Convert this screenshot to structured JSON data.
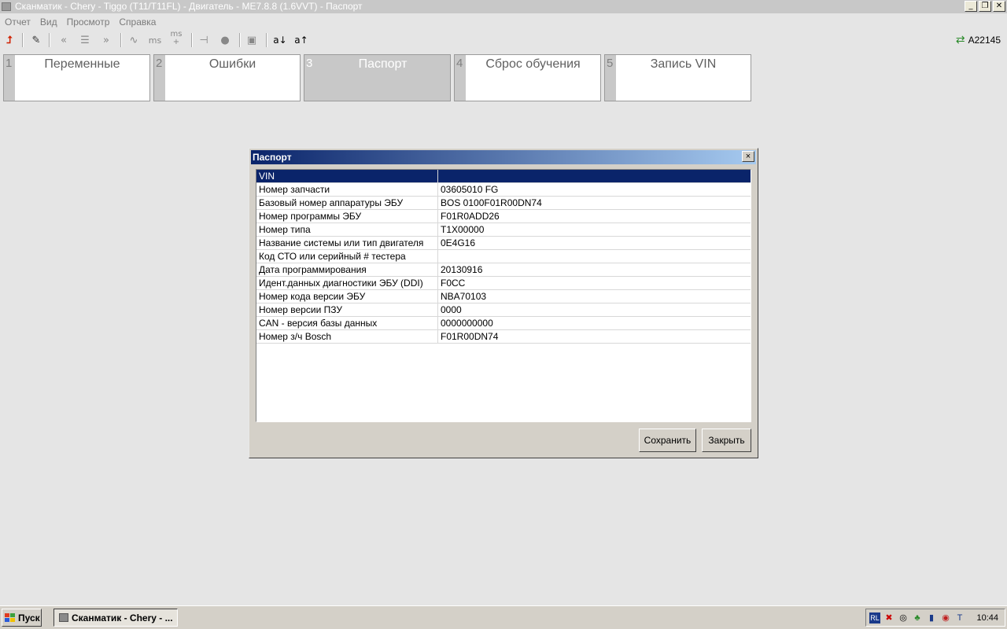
{
  "window": {
    "title": "Сканматик - Chery - Tiggo (T11/T11FL) - Двигатель - ME7.8.8 (1.6VVT) - Паспорт"
  },
  "menu": [
    "Отчет",
    "Вид",
    "Просмотр",
    "Справка"
  ],
  "toolbar": {
    "ms_label": "ms",
    "ms_plus_label": "ms",
    "a_down": "a↓",
    "a_up": "a↑",
    "user": "A22145"
  },
  "tabs": [
    {
      "num": "1",
      "label": "Переменные"
    },
    {
      "num": "2",
      "label": "Ошибки"
    },
    {
      "num": "3",
      "label": "Паспорт"
    },
    {
      "num": "4",
      "label": "Сброс обучения"
    },
    {
      "num": "5",
      "label": "Запись VIN"
    }
  ],
  "active_tab": "3",
  "dialog": {
    "title": "Паспорт",
    "close": "×",
    "rows": [
      {
        "key": "VIN",
        "value": ""
      },
      {
        "key": "Номер запчасти",
        "value": "03605010 FG"
      },
      {
        "key": "Базовый номер аппаратуры ЭБУ",
        "value": "BOS  0100F01R00DN74"
      },
      {
        "key": "Номер программы ЭБУ",
        "value": "F01R0ADD26"
      },
      {
        "key": "Номер типа",
        "value": "T1X00000"
      },
      {
        "key": "Название системы или тип двигателя",
        "value": "0E4G16"
      },
      {
        "key": "Код СТО или серийный # тестера",
        "value": ""
      },
      {
        "key": "Дата программирования",
        "value": "20130916"
      },
      {
        "key": "Идент.данных диагностики ЭБУ (DDI)",
        "value": "F0CC"
      },
      {
        "key": "Номер кода версии ЭБУ",
        "value": "NBA70103"
      },
      {
        "key": "Номер версии ПЗУ",
        "value": "0000"
      },
      {
        "key": "CAN - версия базы данных",
        "value": "0000000000"
      },
      {
        "key": "Номер з/ч Bosch",
        "value": "F01R00DN74"
      }
    ],
    "save_label": "Сохранить",
    "close_label": "Закрыть"
  },
  "taskbar": {
    "start": "Пуск",
    "task": "Сканматик - Chery - ...",
    "lang": "RL",
    "clock": "10:44"
  }
}
